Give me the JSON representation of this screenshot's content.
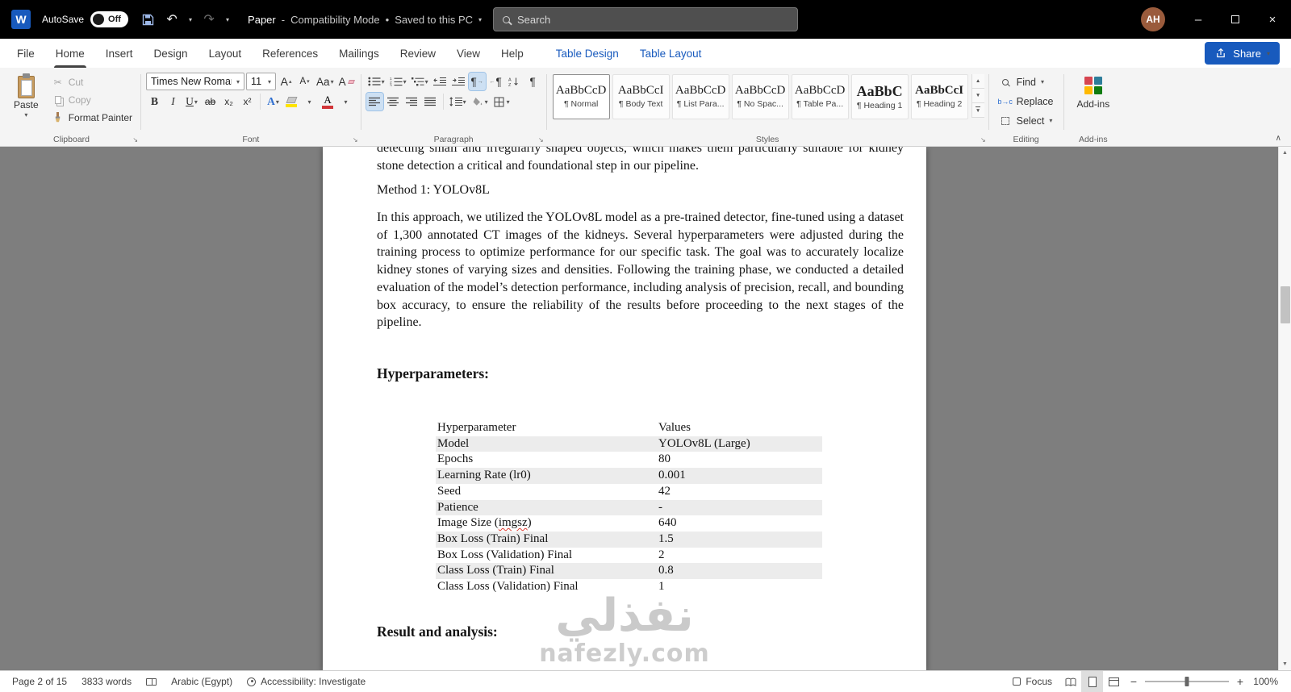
{
  "titlebar": {
    "autosave_label": "AutoSave",
    "autosave_state": "Off",
    "doc_title": "Paper",
    "title_separator": "-",
    "mode": "Compatibility Mode",
    "bullet": "•",
    "saved_status": "Saved to this PC",
    "search_placeholder": "Search",
    "avatar_initials": "AH"
  },
  "menu": {
    "tabs": [
      "File",
      "Home",
      "Insert",
      "Design",
      "Layout",
      "References",
      "Mailings",
      "Review",
      "View",
      "Help"
    ],
    "active_tab": "Home",
    "contextual_tabs": [
      "Table Design",
      "Table Layout"
    ],
    "share_label": "Share"
  },
  "ribbon": {
    "clipboard": {
      "group_label": "Clipboard",
      "paste_label": "Paste",
      "cut_label": "Cut",
      "copy_label": "Copy",
      "format_painter_label": "Format Painter"
    },
    "font": {
      "group_label": "Font",
      "font_name": "Times New Roman",
      "font_size": "11",
      "grow": "A",
      "shrink": "A",
      "change_case": "Aa",
      "clear": "A",
      "bold": "B",
      "italic": "I",
      "underline": "U",
      "strikethrough": "ab",
      "subscript": "x₂",
      "superscript": "x²",
      "effects": "A",
      "color": "A"
    },
    "paragraph": {
      "group_label": "Paragraph",
      "pilcrow": "¶"
    },
    "styles": {
      "group_label": "Styles",
      "items": [
        {
          "preview": "AaBbCcD",
          "label": "¶ Normal"
        },
        {
          "preview": "AaBbCcI",
          "label": "¶ Body Text"
        },
        {
          "preview": "AaBbCcD",
          "label": "¶ List Para..."
        },
        {
          "preview": "AaBbCcD",
          "label": "¶ No Spac..."
        },
        {
          "preview": "AaBbCcD",
          "label": "¶ Table Pa..."
        },
        {
          "preview": "AaBbC",
          "label": "¶ Heading 1"
        },
        {
          "preview": "AaBbCcI",
          "label": "¶ Heading 2"
        }
      ]
    },
    "editing": {
      "group_label": "Editing",
      "find_label": "Find",
      "replace_label": "Replace",
      "select_label": "Select"
    },
    "addins": {
      "group_label": "Add-ins",
      "button_label": "Add-ins"
    }
  },
  "document": {
    "clipped_paragraph": "detecting small and irregularly shaped objects, which makes them particularly suitable for kidney stone detection a critical and foundational step in our pipeline.",
    "method_heading": "Method 1: YOLOv8L",
    "body_paragraph": "In this approach, we utilized the YOLOv8L model as a pre-trained detector, fine-tuned using a dataset of 1,300 annotated CT images of the kidneys. Several hyperparameters were adjusted during the training process to optimize performance for our specific task. The goal was to accurately localize kidney stones of varying sizes and densities. Following the training phase, we conducted a detailed evaluation of the model’s detection performance, including analysis of precision, recall, and bounding box accuracy, to ensure the reliability of the results before proceeding to the next stages of the pipeline.",
    "hyperparameters_heading": "Hyperparameters:",
    "table": {
      "headers": [
        "Hyperparameter",
        "Values"
      ],
      "rows": [
        [
          "Model",
          "YOLOv8L (Large)"
        ],
        [
          "Epochs",
          "80"
        ],
        [
          "Learning Rate (lr0)",
          "0.001"
        ],
        [
          "Seed",
          "42"
        ],
        [
          "Patience",
          "-"
        ],
        [
          "Image Size (imgsz)",
          "640"
        ],
        [
          "Box Loss (Train) Final",
          "1.5"
        ],
        [
          "Box Loss (Validation) Final",
          "2"
        ],
        [
          "Class Loss (Train) Final",
          "0.8"
        ],
        [
          "Class Loss (Validation) Final",
          "1"
        ]
      ],
      "spellcheck_flagged": "imgsz"
    },
    "result_heading": "Result and analysis:",
    "watermark": {
      "arabic": "نفذلي",
      "latin": "nafezly.com"
    }
  },
  "statusbar": {
    "page_info": "Page 2 of 15",
    "word_count": "3833 words",
    "language": "Arabic (Egypt)",
    "accessibility": "Accessibility: Investigate",
    "focus_label": "Focus",
    "zoom_out": "−",
    "zoom_in": "+",
    "zoom_level": "100%"
  },
  "colors": {
    "accent_blue": "#185abd",
    "titlebar_black": "#000000",
    "canvas_gray": "#7e7e7e",
    "table_band_gray": "#ececec",
    "highlight_yellow": "#ffe400",
    "font_color_red": "#d13438"
  }
}
